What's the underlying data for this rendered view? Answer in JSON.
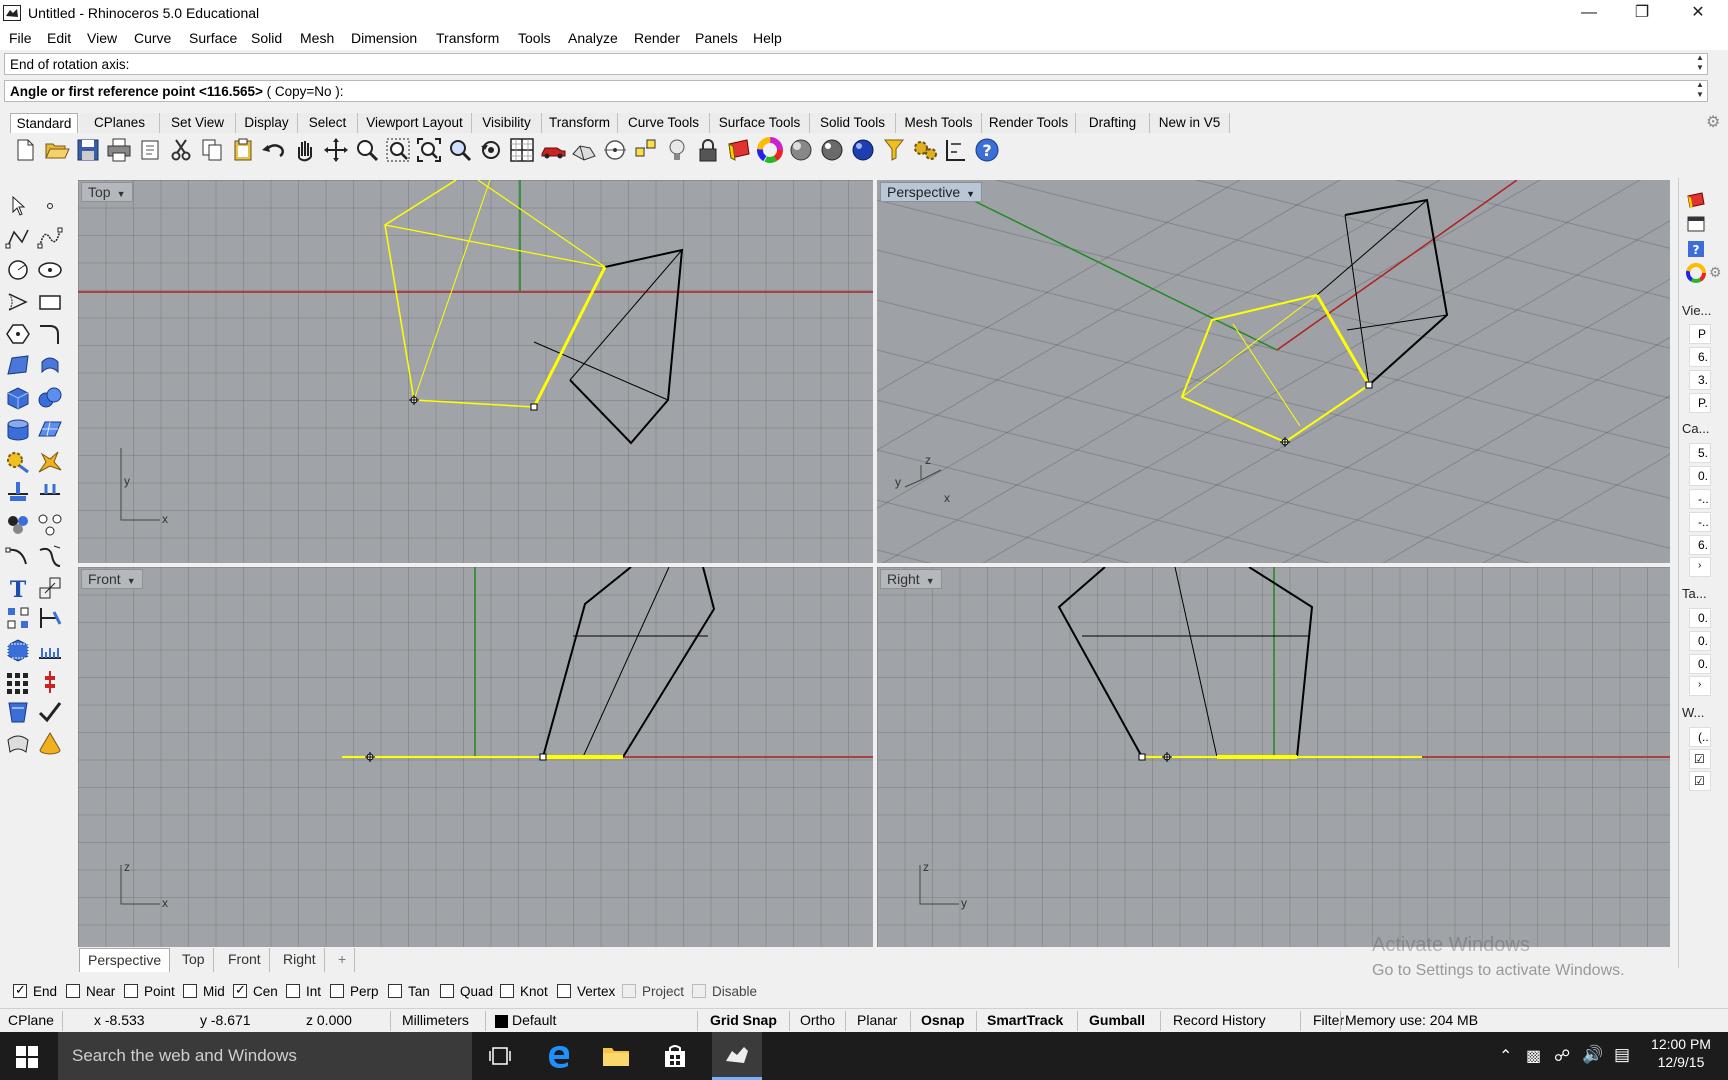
{
  "window": {
    "title": "Untitled - Rhinoceros 5.0 Educational"
  },
  "menu": [
    "File",
    "Edit",
    "View",
    "Curve",
    "Surface",
    "Solid",
    "Mesh",
    "Dimension",
    "Transform",
    "Tools",
    "Analyze",
    "Render",
    "Panels",
    "Help"
  ],
  "command": {
    "history": "End of rotation axis:",
    "prompt_bold": "Angle or first reference point <116.565>",
    "prompt_rest": " ( Copy=No ):"
  },
  "tabs": [
    "Standard",
    "CPlanes",
    "Set View",
    "Display",
    "Select",
    "Viewport Layout",
    "Visibility",
    "Transform",
    "Curve Tools",
    "Surface Tools",
    "Solid Tools",
    "Mesh Tools",
    "Render Tools",
    "Drafting",
    "New in V5"
  ],
  "toolbar_icons": [
    "new-icon",
    "open-icon",
    "save-icon",
    "print-icon",
    "import-icon",
    "cut-icon",
    "copy-icon",
    "paste-icon",
    "undo-icon",
    "pan-icon",
    "rotate-view-icon",
    "zoom-icon",
    "zoom-window-icon",
    "zoom-extents-icon",
    "zoom-selected-icon",
    "rotate-camera-icon",
    "four-viewports-icon",
    "car-render-icon",
    "display-mode-icon",
    "cplane-icon",
    "snap-icon",
    "light-icon",
    "lock-icon",
    "layer-icon",
    "color-wheel-icon",
    "render-sphere-icon",
    "shaded-sphere-icon",
    "blue-sphere-icon",
    "filter-icon",
    "options-gear-icon",
    "dimension-icon",
    "help-icon"
  ],
  "viewports": {
    "top": {
      "label": "Top",
      "axis_a": "y",
      "axis_b": "x"
    },
    "perspective": {
      "label": "Perspective",
      "axis_a": "z",
      "axis_b": "y",
      "axis_c": "x"
    },
    "front": {
      "label": "Front",
      "axis_a": "z",
      "axis_b": "x"
    },
    "right": {
      "label": "Right",
      "axis_a": "z",
      "axis_b": "y"
    }
  },
  "viewport_tabs": [
    "Perspective",
    "Top",
    "Front",
    "Right",
    "+"
  ],
  "osnap": [
    {
      "label": "End",
      "checked": true
    },
    {
      "label": "Near",
      "checked": false
    },
    {
      "label": "Point",
      "checked": false
    },
    {
      "label": "Mid",
      "checked": false
    },
    {
      "label": "Cen",
      "checked": true
    },
    {
      "label": "Int",
      "checked": false
    },
    {
      "label": "Perp",
      "checked": false
    },
    {
      "label": "Tan",
      "checked": false
    },
    {
      "label": "Quad",
      "checked": false
    },
    {
      "label": "Knot",
      "checked": false
    },
    {
      "label": "Vertex",
      "checked": false
    },
    {
      "label": "Project",
      "checked": false
    },
    {
      "label": "Disable",
      "checked": false
    }
  ],
  "status": {
    "cplane": "CPlane",
    "x": "x -8.533",
    "y": "y -8.671",
    "z": "z 0.000",
    "units": "Millimeters",
    "layer": "Default",
    "grid_snap": "Grid Snap",
    "ortho": "Ortho",
    "planar": "Planar",
    "osnap": "Osnap",
    "smarttrack": "SmartTrack",
    "gumball": "Gumball",
    "record_history": "Record History",
    "filter": "Filter",
    "memory": "Memory use: 204 MB"
  },
  "activate": {
    "line1": "Activate Windows",
    "line2": "Go to Settings to activate Windows."
  },
  "right_panel": {
    "section1": "Vie...",
    "s1_vals": [
      "P",
      "6.",
      "3.",
      "P."
    ],
    "section2": "Ca...",
    "s2_vals": [
      "5.",
      "0.",
      "-..",
      "-..",
      "6."
    ],
    "section3": "Ta...",
    "s3_vals": [
      "0.",
      "0.",
      "0."
    ],
    "section4": "W...",
    "s4_vals": [
      "(.."
    ]
  },
  "taskbar": {
    "search": "Search the web and Windows",
    "time": "12:00 PM",
    "date": "12/9/15"
  },
  "colors": {
    "selection": "#ffff00",
    "x_axis": "#b02020",
    "y_axis": "#1e8a1e",
    "curve": "#000000",
    "viewport_bg": "#a0a4a8"
  }
}
